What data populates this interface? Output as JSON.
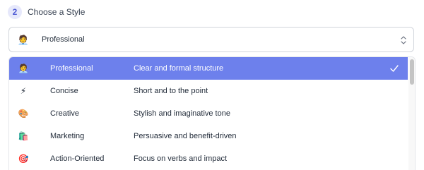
{
  "step": {
    "number": "2",
    "title": "Choose a Style"
  },
  "select": {
    "emoji": "🧑‍💼",
    "value": "Professional",
    "icon": "chevron-up-down-icon"
  },
  "options": [
    {
      "emoji": "🧑‍💼",
      "icon": "professional-person-icon",
      "name": "Professional",
      "description": "Clear and formal structure",
      "selected": true
    },
    {
      "emoji": "⚡",
      "icon": "lightning-icon",
      "name": "Concise",
      "description": "Short and to the point",
      "selected": false
    },
    {
      "emoji": "🎨",
      "icon": "palette-icon",
      "name": "Creative",
      "description": "Stylish and imaginative tone",
      "selected": false
    },
    {
      "emoji": "🛍️",
      "icon": "shopping-bags-icon",
      "name": "Marketing",
      "description": "Persuasive and benefit-driven",
      "selected": false
    },
    {
      "emoji": "🎯",
      "icon": "target-icon",
      "name": "Action-Oriented",
      "description": "Focus on verbs and impact",
      "selected": false
    }
  ],
  "colors": {
    "selected_bg": "#6d80ec",
    "badge_bg": "#e6e8fb",
    "badge_text": "#4f5bd5"
  }
}
